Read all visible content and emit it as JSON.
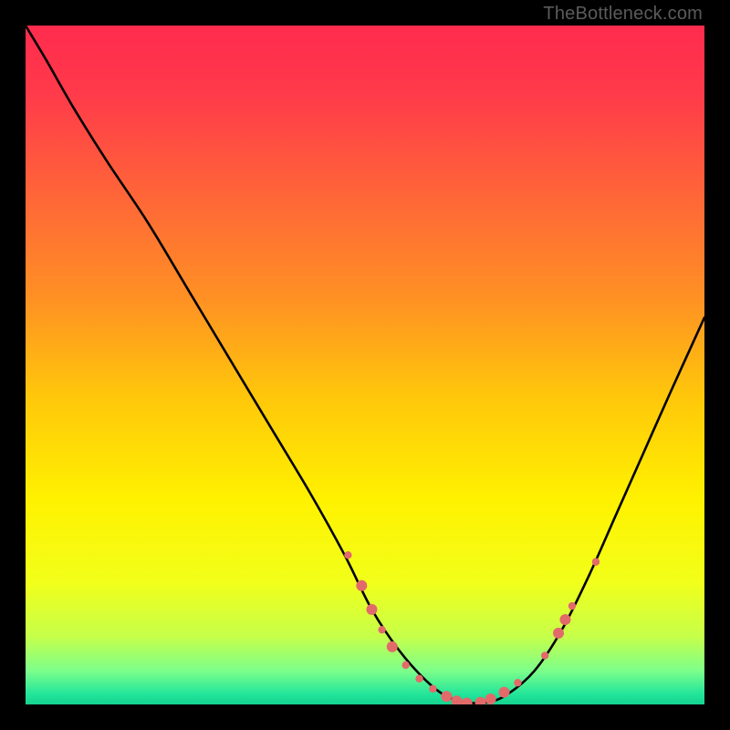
{
  "watermark": "TheBottleneck.com",
  "chart_data": {
    "type": "line",
    "title": "",
    "xlabel": "",
    "ylabel": "",
    "xlim": [
      0,
      100
    ],
    "ylim": [
      0,
      100
    ],
    "grid": false,
    "legend": false,
    "background_gradient": {
      "stops": [
        {
          "offset": 0.0,
          "color": "#ff2b4e"
        },
        {
          "offset": 0.1,
          "color": "#ff3a4a"
        },
        {
          "offset": 0.25,
          "color": "#ff6538"
        },
        {
          "offset": 0.4,
          "color": "#ff9024"
        },
        {
          "offset": 0.55,
          "color": "#ffc80a"
        },
        {
          "offset": 0.7,
          "color": "#fff200"
        },
        {
          "offset": 0.82,
          "color": "#f2ff1a"
        },
        {
          "offset": 0.9,
          "color": "#c6ff4a"
        },
        {
          "offset": 0.95,
          "color": "#7dff8a"
        },
        {
          "offset": 0.985,
          "color": "#22e59a"
        },
        {
          "offset": 1.0,
          "color": "#15d38f"
        }
      ]
    },
    "series": [
      {
        "name": "bottleneck-curve",
        "color": "#000000",
        "x": [
          0,
          3,
          7,
          12,
          18,
          24,
          30,
          36,
          42,
          47,
          51,
          55,
          59,
          62,
          65,
          68,
          71,
          75,
          79,
          83,
          87,
          91,
          95,
          100
        ],
        "y": [
          100,
          95,
          88,
          80,
          71,
          61,
          51,
          41,
          31,
          22,
          14,
          8,
          3.5,
          1.2,
          0.3,
          0.3,
          1.5,
          5,
          11,
          19,
          28,
          37,
          46,
          57
        ]
      }
    ],
    "markers": {
      "color": "#e26a6a",
      "radius_small": 4.2,
      "radius_large": 6.0,
      "points": [
        {
          "x": 47.5,
          "y": 22.0,
          "r": "small"
        },
        {
          "x": 49.5,
          "y": 17.5,
          "r": "large"
        },
        {
          "x": 51.0,
          "y": 14.0,
          "r": "large"
        },
        {
          "x": 52.5,
          "y": 11.0,
          "r": "small"
        },
        {
          "x": 54.0,
          "y": 8.5,
          "r": "large"
        },
        {
          "x": 56.0,
          "y": 5.8,
          "r": "small"
        },
        {
          "x": 58.0,
          "y": 3.8,
          "r": "small"
        },
        {
          "x": 60.0,
          "y": 2.3,
          "r": "small"
        },
        {
          "x": 62.0,
          "y": 1.2,
          "r": "large"
        },
        {
          "x": 63.5,
          "y": 0.5,
          "r": "large"
        },
        {
          "x": 65.0,
          "y": 0.2,
          "r": "large"
        },
        {
          "x": 67.0,
          "y": 0.3,
          "r": "large"
        },
        {
          "x": 68.5,
          "y": 0.8,
          "r": "large"
        },
        {
          "x": 70.5,
          "y": 1.8,
          "r": "large"
        },
        {
          "x": 72.5,
          "y": 3.2,
          "r": "small"
        },
        {
          "x": 76.5,
          "y": 7.2,
          "r": "small"
        },
        {
          "x": 78.5,
          "y": 10.5,
          "r": "large"
        },
        {
          "x": 79.5,
          "y": 12.5,
          "r": "large"
        },
        {
          "x": 80.5,
          "y": 14.5,
          "r": "small"
        },
        {
          "x": 84.0,
          "y": 21.0,
          "r": "small"
        }
      ]
    }
  }
}
